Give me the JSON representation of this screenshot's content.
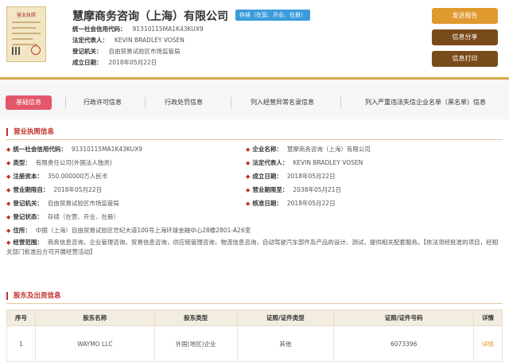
{
  "header": {
    "license_thumb_title": "营业执照",
    "company_name": "慧摩商务咨询（上海）有限公司",
    "status_badge": "存续（在营、开业、在册）",
    "rows": [
      {
        "label": "统一社会信用代码：",
        "value": "91310115MA1K43KUX9"
      },
      {
        "label": "法定代表人：",
        "value": "KEVIN BRADLEY VOSEN"
      },
      {
        "label": "登记机关：",
        "value": "自由贸易试验区市场监管局"
      },
      {
        "label": "成立日期：",
        "value": "2018年05月22日"
      }
    ],
    "buttons": {
      "report": "发送报告",
      "share": "信息分享",
      "print": "信息打印"
    }
  },
  "tabs": [
    {
      "label": "基础信息",
      "active": true
    },
    {
      "label": "行政许可信息"
    },
    {
      "label": "行政处罚信息"
    },
    {
      "label": "列入经营异常名录信息"
    },
    {
      "label": "列入严重违法失信企业名单（黑名单）信息"
    }
  ],
  "business": {
    "title": "营业执照信息",
    "left": [
      {
        "label": "统一社会信用代码：",
        "value": "91310115MA1K43KUX9"
      },
      {
        "label": "类型：",
        "value": "有限责任公司(外国法人独资)"
      },
      {
        "label": "注册资本：",
        "value": "350.000000万人民币"
      },
      {
        "label": "营业期限自：",
        "value": "2018年05月22日"
      },
      {
        "label": "登记机关：",
        "value": "自由贸易试验区市场监管局"
      },
      {
        "label": "登记状态：",
        "value": "存续（在营、开业、在册）"
      }
    ],
    "right": [
      {
        "label": "企业名称：",
        "value": "慧摩商务咨询（上海）有限公司"
      },
      {
        "label": "法定代表人：",
        "value": "KEVIN BRADLEY VOSEN"
      },
      {
        "label": "成立日期：",
        "value": "2018年05月22日"
      },
      {
        "label": "营业期限至：",
        "value": "2038年05月21日"
      },
      {
        "label": "核准日期：",
        "value": "2018年05月22日"
      }
    ],
    "address": {
      "label": "住所：",
      "value": "中国（上海）自由贸易试验区世纪大道100号上海环球金融中心28楼2801-A26室"
    },
    "scope": {
      "label": "经营范围：",
      "value": "商务信息咨询，企业管理咨询，贸易信息咨询，供应链管理咨询，物流信息咨询，自动驾驶汽车部件及产品的设计、测试，提供相关配套服务。【依法须经批准的项目，经相关部门批准后方可开展经营活动】"
    }
  },
  "shareholders": {
    "title": "股东及出资信息",
    "columns": [
      "序号",
      "股东名称",
      "股东类型",
      "证照/证件类型",
      "证照/证件号码",
      "详情"
    ],
    "rows": [
      {
        "no": "1",
        "name": "WAYMO LLC",
        "type": "外国(地区)企业",
        "cert_type": "其他",
        "cert_no": "6073396",
        "detail": "详情"
      }
    ]
  },
  "colors": {
    "accent": "#c0302b",
    "gold": "#d4a84c",
    "tab_active": "#e4576a",
    "badge": "#3b9cdc",
    "button_dark": "#7a4b1a",
    "button_orange": "#e0992d"
  }
}
